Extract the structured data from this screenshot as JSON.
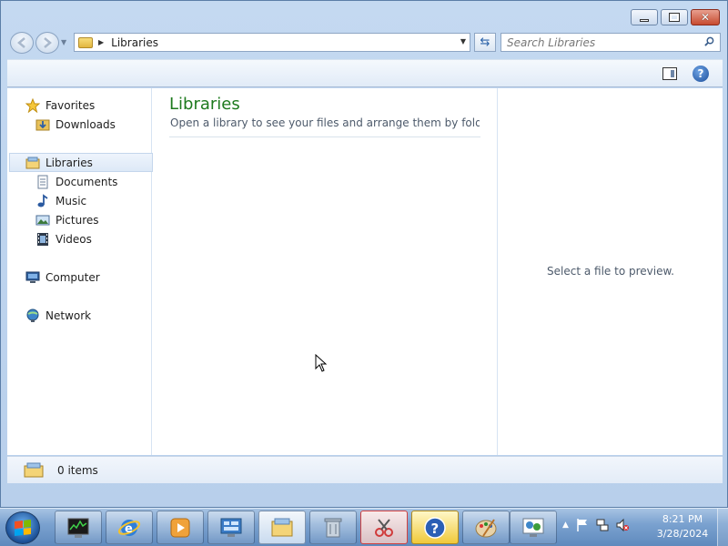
{
  "window": {
    "buttons": {
      "minimize": "minimize",
      "maximize": "maximize",
      "close": "close"
    }
  },
  "navbar": {
    "address_path": "Libraries",
    "search_placeholder": "Search Libraries"
  },
  "sidebar": {
    "items": [
      {
        "label": "Favorites",
        "icon": "star-icon",
        "level": "top"
      },
      {
        "label": "Downloads",
        "icon": "downloads-folder-icon",
        "level": "sub"
      },
      {
        "label": "Libraries",
        "icon": "libraries-icon",
        "level": "top",
        "selected": true
      },
      {
        "label": "Documents",
        "icon": "documents-icon",
        "level": "sub"
      },
      {
        "label": "Music",
        "icon": "music-icon",
        "level": "sub"
      },
      {
        "label": "Pictures",
        "icon": "pictures-icon",
        "level": "sub"
      },
      {
        "label": "Videos",
        "icon": "videos-icon",
        "level": "sub"
      },
      {
        "label": "Computer",
        "icon": "computer-icon",
        "level": "top"
      },
      {
        "label": "Network",
        "icon": "network-icon",
        "level": "top"
      }
    ]
  },
  "main": {
    "title": "Libraries",
    "description": "Open a library to see your files and arrange them by folder, d..."
  },
  "preview": {
    "message": "Select a file to preview."
  },
  "details": {
    "item_count": "0 items"
  },
  "taskbar": {
    "pinned": [
      "task-manager-icon",
      "internet-explorer-icon",
      "media-player-icon",
      "remote-desktop-icon",
      "windows-explorer-icon",
      "recycle-icon",
      "snipping-tool-icon",
      "help-icon",
      "paint-icon",
      "network-connections-icon"
    ],
    "clock_time": "8:21 PM",
    "clock_date": "3/28/2024"
  },
  "colors": {
    "title_green": "#1e7a1e",
    "taskbar_blue": "#5f8abd",
    "selection": "#dde9f7"
  }
}
